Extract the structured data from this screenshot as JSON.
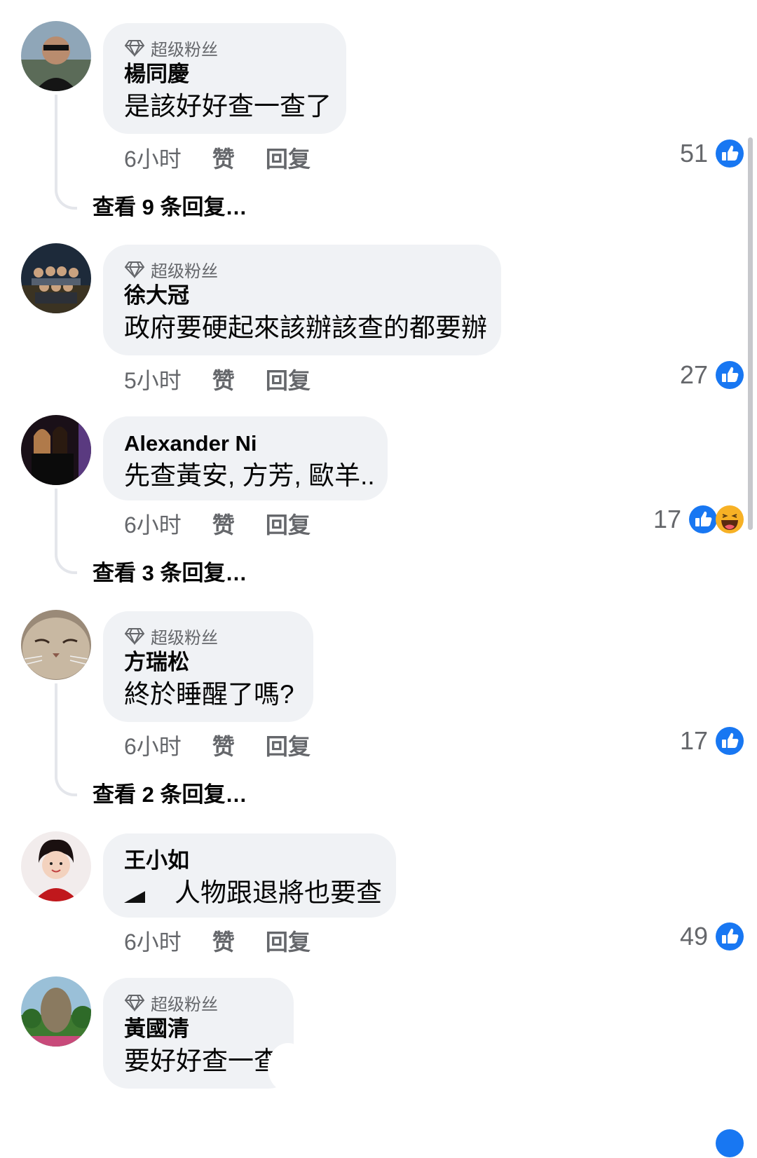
{
  "badge_label": "超级粉丝",
  "like_label": "赞",
  "reply_label": "回复",
  "comments": [
    {
      "author": "楊同慶",
      "text": "是該好好查一查了",
      "time": "6小时",
      "reactions": "51",
      "replies": "查看 9 条回复…"
    },
    {
      "author": "徐大冠",
      "text": "政府要硬起來該辦該查的都要辦",
      "time": "5小时",
      "reactions": "27"
    },
    {
      "author": "Alexander Ni",
      "text": "先查黃安, 方芳, 歐羊..",
      "time": "6小时",
      "reactions": "17",
      "replies": "查看 3 条回复…"
    },
    {
      "author": "方瑞松",
      "text": "終於睡醒了嗎?",
      "time": "6小时",
      "reactions": "17",
      "replies": "查看 2 条回复…"
    },
    {
      "author": "王小如",
      "text": "人物跟退將也要查",
      "time": "6小时",
      "reactions": "49"
    },
    {
      "author": "黃國清",
      "text": "要好好查一查",
      "time": "",
      "reactions": ""
    }
  ],
  "colors": {
    "like_blue": "#1877f2",
    "bubble_bg": "#f0f2f5",
    "secondary_text": "#65676b"
  }
}
